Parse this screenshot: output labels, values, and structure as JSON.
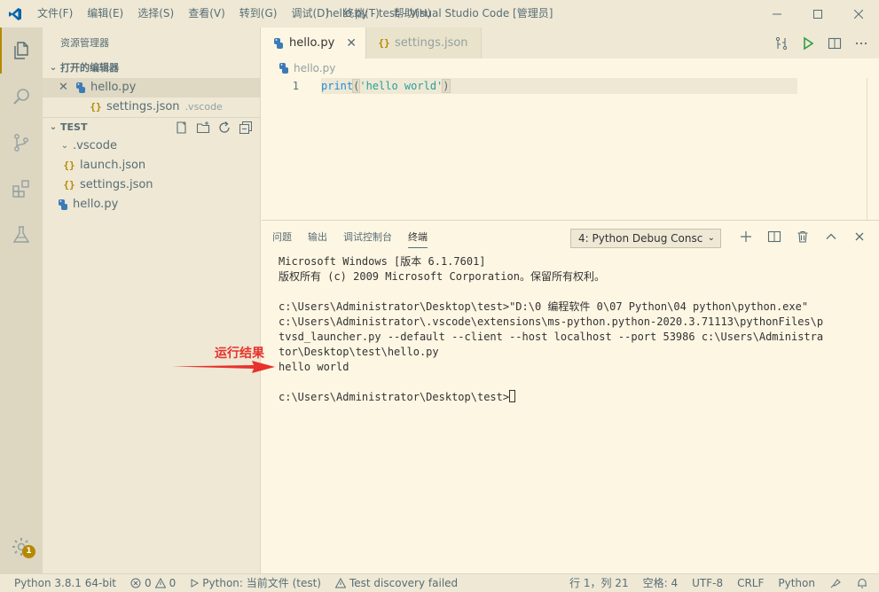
{
  "titlebar": {
    "menu": [
      "文件(F)",
      "编辑(E)",
      "选择(S)",
      "查看(V)",
      "转到(G)",
      "调试(D)",
      "终端(T)",
      "帮助(H)"
    ],
    "title": "hello.py - test - Visual Studio Code [管理员]"
  },
  "activitybar": {
    "badge": "1"
  },
  "sidebar": {
    "title": "资源管理器",
    "open_editors": {
      "label": "打开的编辑器",
      "items": [
        {
          "name": "hello.py",
          "desc": ""
        },
        {
          "name": "settings.json",
          "desc": ".vscode"
        }
      ]
    },
    "workspace": {
      "label": "TEST",
      "folder": ".vscode",
      "files": [
        "launch.json",
        "settings.json"
      ],
      "root_file": "hello.py"
    }
  },
  "tabs": [
    {
      "label": "hello.py",
      "active": true
    },
    {
      "label": "settings.json",
      "active": false
    }
  ],
  "breadcrumb": "hello.py",
  "editor": {
    "line_number": "1",
    "keyword": "print",
    "open_paren": "(",
    "string": "'hello world'",
    "close_paren": ")"
  },
  "panel": {
    "tabs": [
      "问题",
      "输出",
      "调试控制台",
      "终端"
    ],
    "active_tab": "终端",
    "terminal_select": "4: Python Debug Consc",
    "terminal_lines": [
      "Microsoft Windows [版本 6.1.7601]",
      "版权所有 (c) 2009 Microsoft Corporation。保留所有权利。",
      "",
      "c:\\Users\\Administrator\\Desktop\\test>\"D:\\0 编程软件 0\\07 Python\\04 python\\python.exe\"",
      "c:\\Users\\Administrator\\.vscode\\extensions\\ms-python.python-2020.3.71113\\pythonFiles\\p",
      "tvsd_launcher.py --default --client --host localhost --port 53986 c:\\Users\\Administra",
      "tor\\Desktop\\test\\hello.py",
      "hello world",
      "",
      "c:\\Users\\Administrator\\Desktop\\test>"
    ]
  },
  "annotation": {
    "label": "运行结果",
    "color": "#e8312a"
  },
  "statusbar": {
    "python": "Python 3.8.1 64-bit",
    "errors": "0",
    "warnings": "0",
    "run": "Python: 当前文件 (test)",
    "test": "Test discovery failed",
    "position": "行 1，列 21",
    "spaces": "空格: 4",
    "encoding": "UTF-8",
    "eol": "CRLF",
    "language": "Python"
  },
  "colors": {
    "background": "#fdf6e3",
    "sidebar": "#eee8d5",
    "activitybar": "#ddd6c1",
    "accent": "#b58900",
    "keyword": "#268bd2",
    "string": "#2aa198"
  }
}
